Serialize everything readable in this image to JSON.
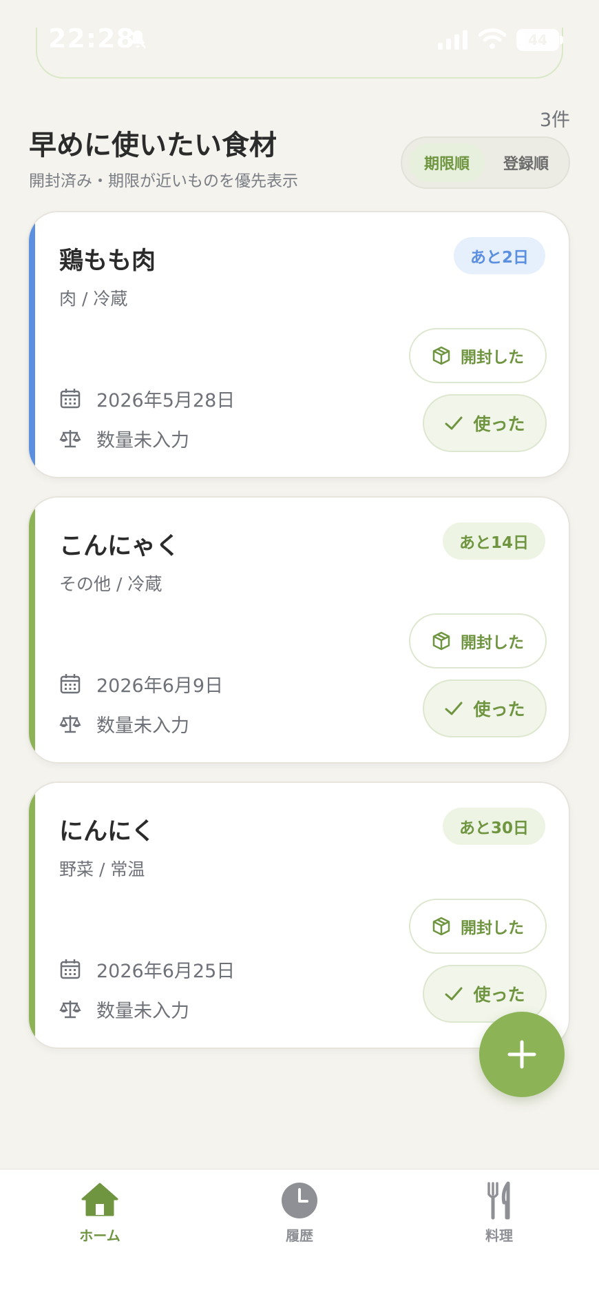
{
  "status_bar": {
    "time": "22:28",
    "battery": "44"
  },
  "section": {
    "title": "早めに使いたい食材",
    "subtitle": "開封済み・期限が近いものを優先表示",
    "count": "3件",
    "sort": {
      "active": "期限順",
      "inactive": "登録順"
    }
  },
  "items": [
    {
      "name": "鶏もも肉",
      "category": "肉 / 冷蔵",
      "days_left": "あと2日",
      "date": "2026年5月28日",
      "quantity": "数量未入力",
      "opened_label": "開封した",
      "used_label": "使った",
      "accent": "#5b8fe0"
    },
    {
      "name": "こんにゃく",
      "category": "その他 / 冷蔵",
      "days_left": "あと14日",
      "date": "2026年6月9日",
      "quantity": "数量未入力",
      "opened_label": "開封した",
      "used_label": "使った",
      "accent": "#8db357"
    },
    {
      "name": "にんにく",
      "category": "野菜 / 常温",
      "days_left": "あと30日",
      "date": "2026年6月25日",
      "quantity": "数量未入力",
      "opened_label": "開封した",
      "used_label": "使った",
      "accent": "#8db357"
    }
  ],
  "nav": {
    "home": "ホーム",
    "history": "履歴",
    "cooking": "料理"
  },
  "icons": {
    "calendar": "calendar-icon",
    "scale": "scale-icon",
    "box": "box-icon",
    "check": "check-icon",
    "plus": "plus-icon",
    "home": "home-icon",
    "clock": "clock-icon",
    "utensils": "utensils-icon"
  },
  "colors": {
    "accent_green": "#8db357",
    "text_green": "#6f9540",
    "accent_blue": "#5b8fe0",
    "background": "#f4f3ee"
  }
}
